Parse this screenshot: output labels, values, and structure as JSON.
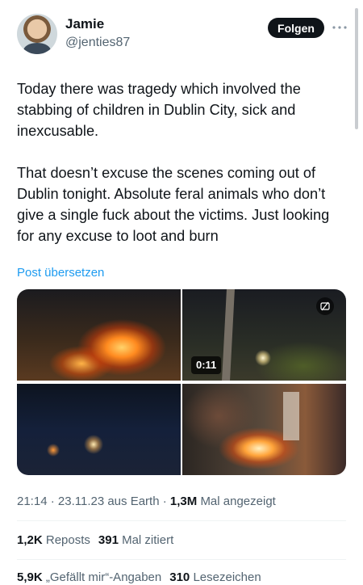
{
  "author": {
    "name": "Jamie",
    "handle": "@jenties87",
    "follow_label": "Folgen",
    "more_icon": "ellipsis-icon"
  },
  "tweet": {
    "paragraphs": [
      "Today there was tragedy which involved the stabbing of children in Dublin City, sick and inexcusable.",
      "That doesn’t excuse the scenes coming out of Dublin tonight. Absolute feral animals who don’t give a single fuck about the victims. Just looking for any excuse to loot and burn"
    ],
    "translate_label": "Post übersetzen"
  },
  "media": {
    "video_duration": "0:11",
    "video_icon": "media-settings-icon"
  },
  "meta": {
    "time": "21:14",
    "date": "23.11.23",
    "source": "aus Earth",
    "views_count": "1,3M",
    "views_label": "Mal angezeigt"
  },
  "stats": {
    "reposts_count": "1,2K",
    "reposts_label": "Reposts",
    "quotes_count": "391",
    "quotes_label": "Mal zitiert",
    "likes_count": "5,9K",
    "likes_label": "„Gefällt mir“-Angaben",
    "bookmarks_count": "310",
    "bookmarks_label": "Lesezeichen"
  },
  "colors": {
    "text": "#0f1419",
    "secondary": "#536471",
    "link": "#1d9bf0",
    "button": "#0f1419"
  }
}
